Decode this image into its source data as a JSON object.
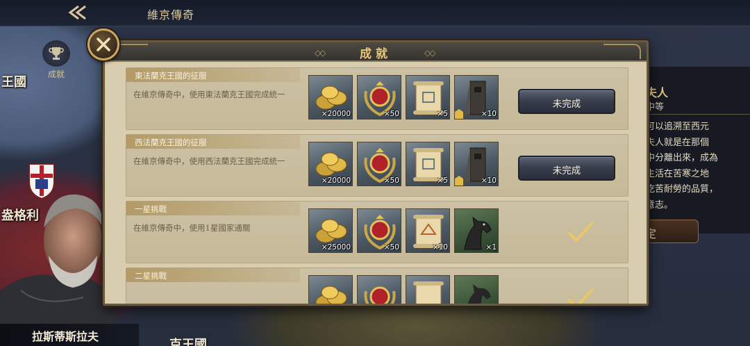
{
  "topbar": {
    "title": "維京傳奇"
  },
  "side": {
    "achievement_label": "成就"
  },
  "map": {
    "labels": [
      "王國",
      "盎格利",
      "克王國"
    ]
  },
  "portrait": {
    "name": "拉斯蒂斯拉夫"
  },
  "right_panel": {
    "title": "夫人",
    "subtitle": "中等",
    "text": [
      "可以追溯至西元",
      "夫人就是在那個",
      "中分離出來，成為",
      "生活在苦寒之地",
      "吃苦耐勞的品質，",
      "意志。"
    ],
    "button": "定"
  },
  "dialog": {
    "title": "成就",
    "items": [
      {
        "title": "東法蘭克王國的征服",
        "desc": "在維京傳奇中，使用東法蘭克王國完成統一",
        "rewards": [
          {
            "icon": "gold-coins-icon",
            "count": "×20000"
          },
          {
            "icon": "medal-icon",
            "count": "×50"
          },
          {
            "icon": "scroll-icon",
            "count": "×5"
          },
          {
            "icon": "siege-tower-icon",
            "count": "×10"
          }
        ],
        "status": "未完成"
      },
      {
        "title": "西法蘭克王國的征服",
        "desc": "在維京傳奇中，使用西法蘭克王國完成統一",
        "rewards": [
          {
            "icon": "gold-coins-icon",
            "count": "×20000"
          },
          {
            "icon": "medal-icon",
            "count": "×50"
          },
          {
            "icon": "scroll-icon",
            "count": "×5"
          },
          {
            "icon": "siege-tower-icon",
            "count": "×10"
          }
        ],
        "status": "未完成"
      },
      {
        "title": "一星挑戰",
        "desc": "在維京傳奇中，使用1星國家通關",
        "rewards": [
          {
            "icon": "gold-coins-icon",
            "count": "×25000"
          },
          {
            "icon": "medal-icon",
            "count": "×50"
          },
          {
            "icon": "scroll-icon",
            "count": "×10"
          },
          {
            "icon": "horse-icon",
            "count": "×1"
          }
        ],
        "status": "completed"
      },
      {
        "title": "二星挑戰",
        "desc": "",
        "rewards": [],
        "status": "completed"
      }
    ]
  },
  "colors": {
    "accent_gold": "#e7c777",
    "parchment": "#d9cdb0",
    "button_dark": "#363c4a"
  }
}
